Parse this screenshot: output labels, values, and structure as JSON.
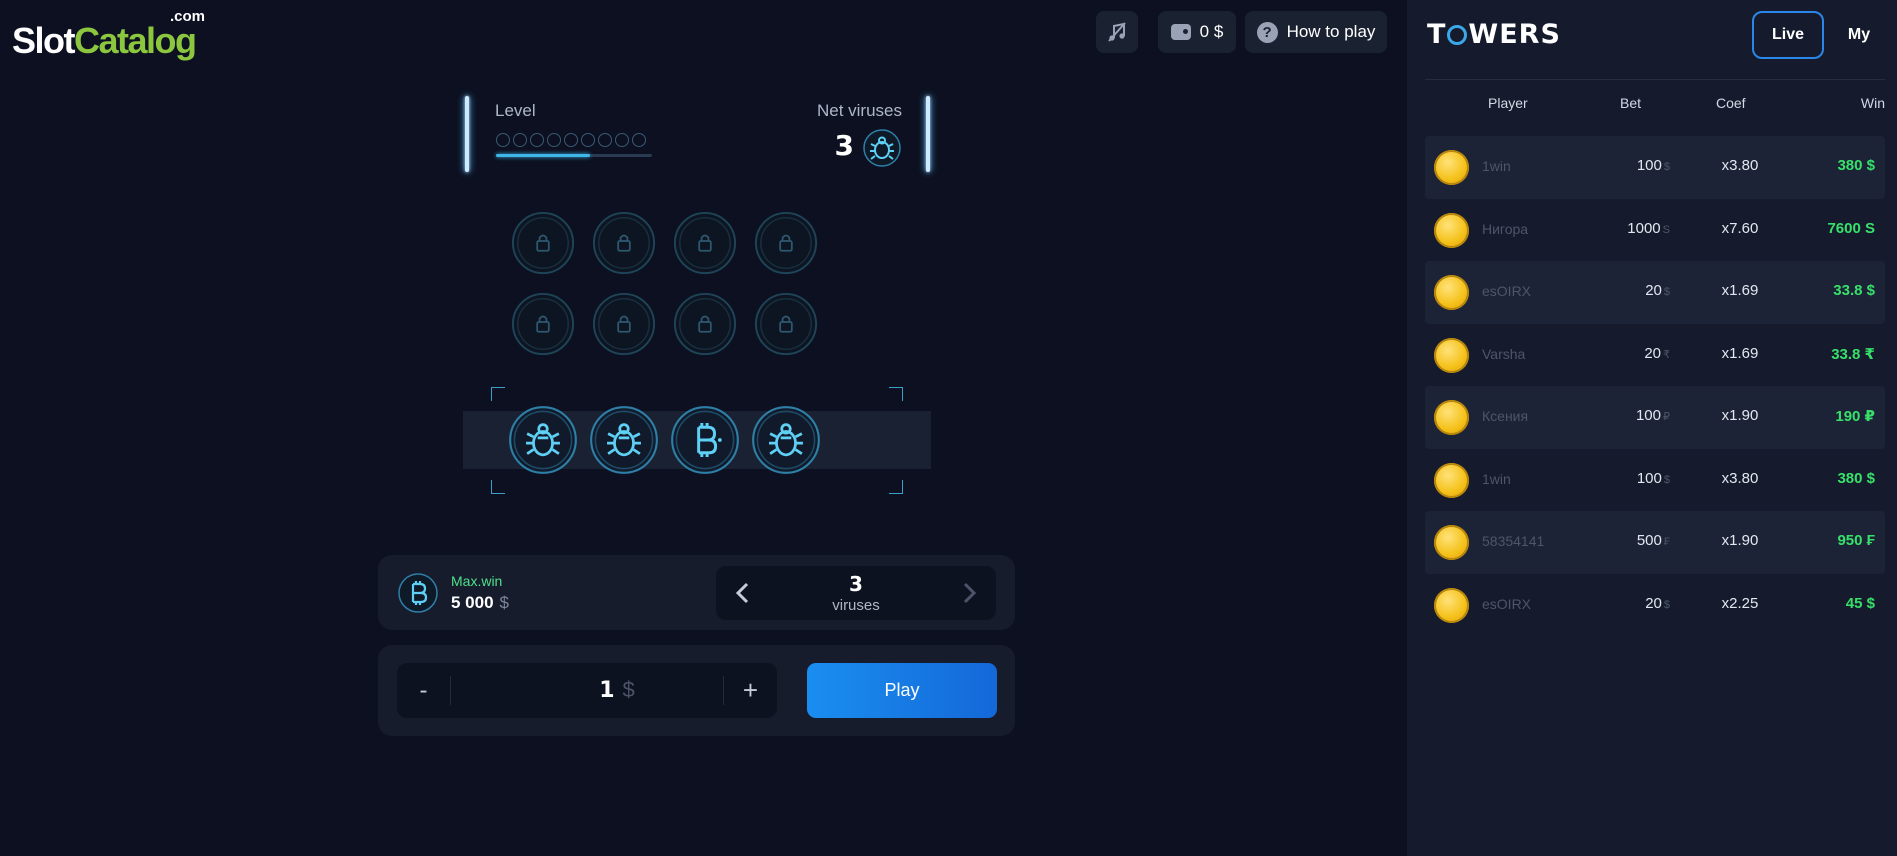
{
  "logo": {
    "com": ".com",
    "slot": "Slot",
    "catalog": "Catalog"
  },
  "toolbar": {
    "balance": "0 $",
    "how_to_play": "How to play"
  },
  "game": {
    "level_label": "Level",
    "level_progress": 0.6,
    "net_viruses_label": "Net viruses",
    "net_viruses_count": "3",
    "grid_rows": [
      {
        "state": "locked",
        "cells": [
          "lock-icon",
          "lock-icon",
          "lock-icon",
          "lock-icon"
        ]
      },
      {
        "state": "locked",
        "cells": [
          "lock-icon",
          "lock-icon",
          "lock-icon",
          "lock-icon"
        ]
      },
      {
        "state": "active",
        "cells": [
          "virus-icon",
          "virus-icon",
          "bitcoin-icon",
          "virus-icon"
        ]
      }
    ],
    "max_win_label": "Max.win",
    "max_win_value": "5 000",
    "max_win_currency": "$",
    "viruses_count": "3",
    "viruses_label": "viruses",
    "bet_minus": "-",
    "bet_value": "1",
    "bet_currency": "$",
    "bet_plus": "+",
    "play_label": "Play"
  },
  "sidebar": {
    "logo": {
      "t": "T",
      "rest": "WERS"
    },
    "tabs": {
      "live": "Live",
      "my": "My"
    },
    "headers": {
      "player": "Player",
      "bet": "Bet",
      "coef": "Coef",
      "win": "Win"
    },
    "rows": [
      {
        "player": "1win",
        "bet": "100",
        "bet_cur": "$",
        "coef": "x3.80",
        "win": "380 $"
      },
      {
        "player": "Нигора",
        "bet": "1000",
        "bet_cur": "S",
        "coef": "x7.60",
        "win": "7600 S"
      },
      {
        "player": "esOIRX",
        "bet": "20",
        "bet_cur": "$",
        "coef": "x1.69",
        "win": "33.8 $"
      },
      {
        "player": "Varsha",
        "bet": "20",
        "bet_cur": "₹",
        "coef": "x1.69",
        "win": "33.8 ₹"
      },
      {
        "player": "Ксения",
        "bet": "100",
        "bet_cur": "₽",
        "coef": "x1.90",
        "win": "190 ₽"
      },
      {
        "player": "1win",
        "bet": "100",
        "bet_cur": "$",
        "coef": "x3.80",
        "win": "380 $"
      },
      {
        "player": "58354141",
        "bet": "500",
        "bet_cur": "₣",
        "coef": "x1.90",
        "win": "950 ₣"
      },
      {
        "player": "esOIRX",
        "bet": "20",
        "bet_cur": "$",
        "coef": "x2.25",
        "win": "45 $"
      }
    ]
  },
  "colors": {
    "accent": "#1a8ef0",
    "win_green": "#37e06a",
    "background": "#0c1020",
    "sidebar": "#151b2c"
  }
}
